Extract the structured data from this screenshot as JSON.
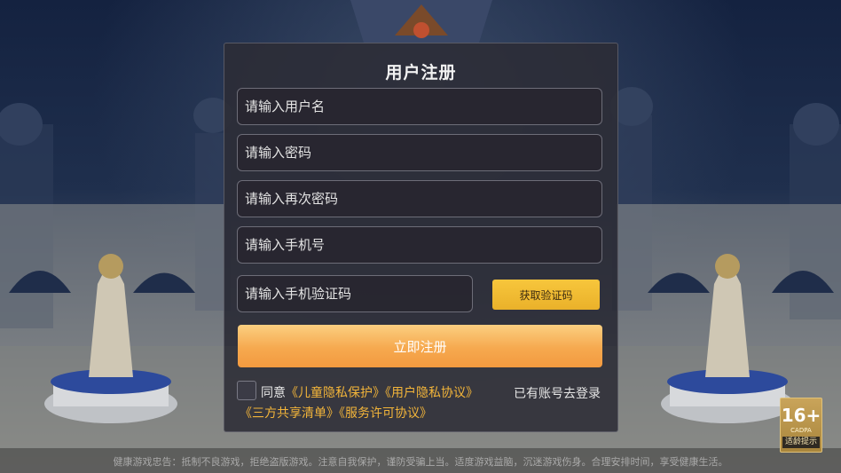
{
  "modal": {
    "title": "用户注册",
    "username_placeholder": "请输入用户名",
    "password_placeholder": "请输入密码",
    "password_confirm_placeholder": "请输入再次密码",
    "phone_placeholder": "请输入手机号",
    "code_placeholder": "请输入手机验证码",
    "get_code_label": "获取验证码",
    "submit_label": "立即注册",
    "agree_prefix": "同意",
    "child_privacy_link": "《儿童隐私保护》",
    "user_privacy_link": "《用户隐私协议》",
    "third_party_link": "《三方共享清单》",
    "service_link": "《服务许可协议》",
    "login_link": "已有账号去登录"
  },
  "footer": {
    "notice": "健康游戏忠告：抵制不良游戏，拒绝盗版游戏。注意自我保护，谨防受骗上当。适度游戏益脑，沉迷游戏伤身。合理安排时间，享受健康生活。"
  },
  "age_badge": {
    "rating": "16+",
    "sub": "CADPA",
    "label": "适龄提示"
  },
  "colors": {
    "accent": "#f3b53a",
    "submit": "#f6a94f",
    "modal_bg": "#2c2c36"
  }
}
